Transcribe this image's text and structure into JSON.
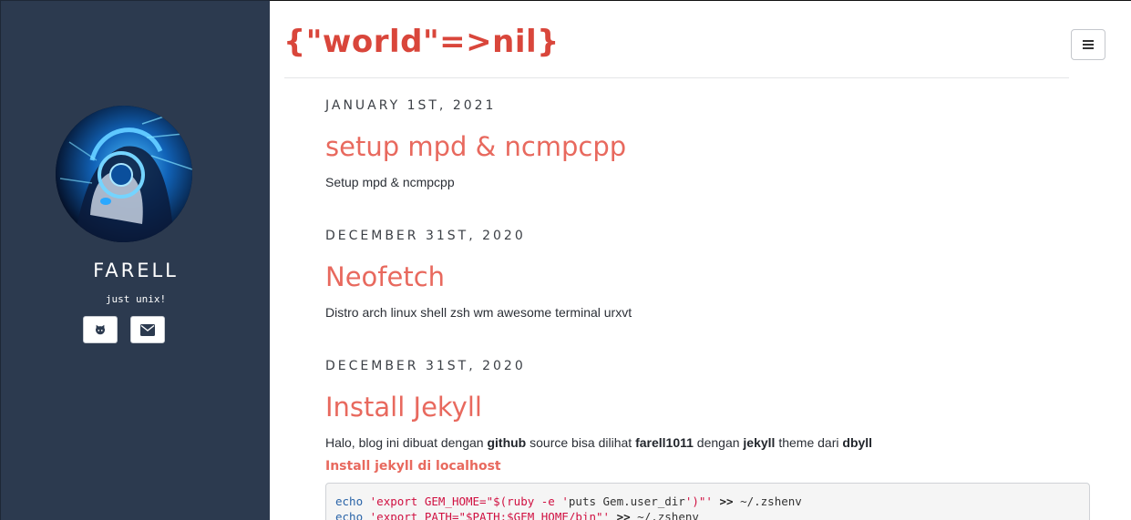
{
  "sidebar": {
    "author": "FARELL",
    "tagline": "just unix!",
    "avatar_alt": "avatar",
    "social": [
      {
        "icon": "github-icon"
      },
      {
        "icon": "mail-icon"
      }
    ]
  },
  "header": {
    "site_title": "{\"world\"=>nil}",
    "menu_icon": "hamburger-icon"
  },
  "posts": [
    {
      "date": "JANUARY 1ST, 2021",
      "title": "setup mpd & ncmpcpp",
      "excerpt": "Setup mpd & ncmpcpp"
    },
    {
      "date": "DECEMBER 31ST, 2020",
      "title": "Neofetch",
      "excerpt": "Distro arch linux shell zsh wm awesome terminal urxvt"
    },
    {
      "date": "DECEMBER 31ST, 2020",
      "title": "Install Jekyll",
      "excerpt_parts": {
        "p1": "Halo, blog ini dibuat dengan ",
        "b1": "github",
        "p2": " source bisa dilihat ",
        "b2": "farell1011",
        "p3": " dengan ",
        "b3": "jekyll",
        "p4": " theme dari ",
        "b4": "dbyll"
      },
      "subheading": "Install jekyll di localhost",
      "code": {
        "line1": {
          "cmd": "echo",
          "s1": "'export GEM_HOME=\"$(ruby -e '",
          "mid": "puts Gem.user_dir",
          "s2": "')\"'",
          "op": ">>",
          "path": "~/.zshenv"
        },
        "line2": {
          "cmd": "echo",
          "s1": "'export PATH=\"$PATH:$GEM_HOME/bin\"'",
          "op": ">>",
          "path": "~/.zshenv"
        }
      }
    }
  ],
  "colors": {
    "sidebar_bg": "#2c3a4f",
    "title_red": "#d9463b",
    "post_title": "#e8695e"
  }
}
